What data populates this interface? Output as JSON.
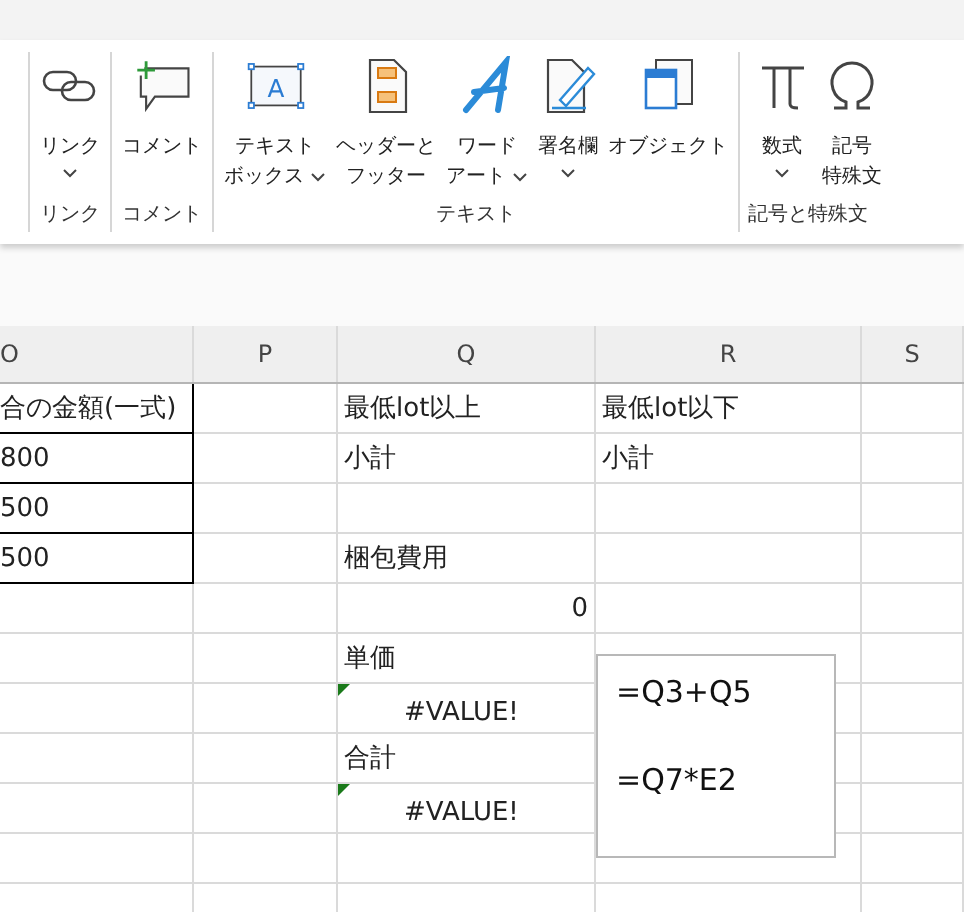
{
  "ribbon": {
    "groups": [
      {
        "label": "リンク",
        "buttons": [
          {
            "lines": [
              "リンク"
            ],
            "dropdown": true
          }
        ]
      },
      {
        "label": "コメント",
        "buttons": [
          {
            "lines": [
              "コメント"
            ],
            "dropdown": false
          }
        ]
      },
      {
        "label": "テキスト",
        "buttons": [
          {
            "icon_letter": "A",
            "lines": [
              "テキスト",
              "ボックス"
            ],
            "dropdown": true
          },
          {
            "lines": [
              "ヘッダーと",
              "フッター"
            ],
            "dropdown": false
          },
          {
            "lines": [
              "ワード",
              "アート"
            ],
            "dropdown": true
          },
          {
            "lines": [
              "署名欄"
            ],
            "dropdown": true
          },
          {
            "lines": [
              "オブジェクト"
            ],
            "dropdown": false
          }
        ]
      },
      {
        "label": "記号と特殊文",
        "buttons": [
          {
            "lines": [
              "数式"
            ],
            "dropdown": true
          },
          {
            "lines": [
              "記号",
              "特殊文"
            ],
            "dropdown": false
          }
        ]
      }
    ]
  },
  "sheet": {
    "columns": [
      "O",
      "P",
      "Q",
      "R",
      "S"
    ],
    "rows": [
      [
        {
          "text": "合の金額(一式)",
          "bordered": true
        },
        {
          "text": ""
        },
        {
          "text": "最低lot以上"
        },
        {
          "text": "最低lot以下"
        },
        {
          "text": ""
        }
      ],
      [
        {
          "text": "800",
          "bordered": true
        },
        {
          "text": ""
        },
        {
          "text": "小計"
        },
        {
          "text": "小計"
        },
        {
          "text": ""
        }
      ],
      [
        {
          "text": "500",
          "bordered": true
        },
        {
          "text": ""
        },
        {
          "text": ""
        },
        {
          "text": ""
        },
        {
          "text": ""
        }
      ],
      [
        {
          "text": "500",
          "bordered": true
        },
        {
          "text": ""
        },
        {
          "text": "梱包費用"
        },
        {
          "text": ""
        },
        {
          "text": ""
        }
      ],
      [
        {
          "text": ""
        },
        {
          "text": ""
        },
        {
          "text": "0",
          "kind": "number"
        },
        {
          "text": ""
        },
        {
          "text": ""
        }
      ],
      [
        {
          "text": ""
        },
        {
          "text": ""
        },
        {
          "text": "単価"
        },
        {
          "text": ""
        },
        {
          "text": ""
        }
      ],
      [
        {
          "text": ""
        },
        {
          "text": ""
        },
        {
          "text": "#VALUE!",
          "kind": "error"
        },
        {
          "text": ""
        },
        {
          "text": ""
        }
      ],
      [
        {
          "text": ""
        },
        {
          "text": ""
        },
        {
          "text": "合計"
        },
        {
          "text": ""
        },
        {
          "text": ""
        }
      ],
      [
        {
          "text": ""
        },
        {
          "text": ""
        },
        {
          "text": "#VALUE!",
          "kind": "error"
        },
        {
          "text": ""
        },
        {
          "text": ""
        }
      ],
      [
        {
          "text": ""
        },
        {
          "text": ""
        },
        {
          "text": ""
        },
        {
          "text": ""
        },
        {
          "text": ""
        }
      ],
      [
        {
          "text": ""
        },
        {
          "text": ""
        },
        {
          "text": ""
        },
        {
          "text": ""
        },
        {
          "text": ""
        }
      ]
    ]
  },
  "textbox": {
    "lines": [
      "=Q3+Q5",
      "=Q7*E2"
    ]
  }
}
